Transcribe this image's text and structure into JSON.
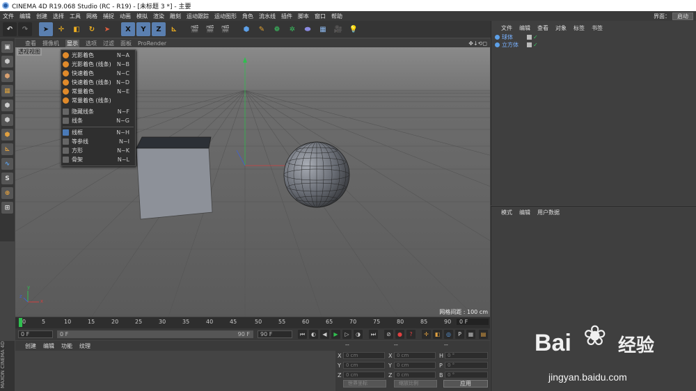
{
  "window": {
    "title": "CINEMA 4D R19.068 Studio (RC - R19) - [未标题 3 *] - 主要"
  },
  "menubar": {
    "items": [
      "文件",
      "编辑",
      "创建",
      "选择",
      "工具",
      "网格",
      "捕捉",
      "动画",
      "模拟",
      "渲染",
      "雕刻",
      "运动跟踪",
      "运动图形",
      "角色",
      "流水线",
      "插件",
      "脚本",
      "窗口",
      "帮助"
    ],
    "layout_label": "界面：",
    "layout_value": "启动"
  },
  "toolbar": {
    "axis_x": "X",
    "axis_y": "Y",
    "axis_z": "Z"
  },
  "viewport_menu": {
    "items": [
      "查看",
      "摄像机",
      "显示",
      "选项",
      "过滤",
      "面板",
      "ProRender"
    ],
    "active": "显示",
    "nav_icons": "✥↓⟲◻"
  },
  "viewport": {
    "label": "透视视图",
    "grid_spacing": "网格间距 : 100 cm",
    "axis_x": "x",
    "axis_y": "y",
    "axis_z": "z"
  },
  "display_menu": {
    "items": [
      {
        "label": "光影着色",
        "shortcut": "N~A",
        "icon": "orange"
      },
      {
        "label": "光影着色 (线条)",
        "shortcut": "N~B",
        "icon": "orange"
      },
      {
        "label": "快速着色",
        "shortcut": "N~C",
        "icon": "orange"
      },
      {
        "label": "快速着色 (线条)",
        "shortcut": "N~D",
        "icon": "orange"
      },
      {
        "label": "常量着色",
        "shortcut": "N~E",
        "icon": "orange"
      },
      {
        "label": "常量着色 (线条)",
        "shortcut": "",
        "icon": "orange"
      },
      {
        "label": "隐藏线条",
        "shortcut": "N~F",
        "icon": "square"
      },
      {
        "label": "线条",
        "shortcut": "N~G",
        "icon": "square"
      },
      {
        "label": "线框",
        "shortcut": "N~H",
        "icon": "blue"
      },
      {
        "label": "等参线",
        "shortcut": "N~I",
        "icon": "square"
      },
      {
        "label": "方形",
        "shortcut": "N~K",
        "icon": "square"
      },
      {
        "label": "骨架",
        "shortcut": "N~L",
        "icon": "square"
      }
    ]
  },
  "timeline": {
    "ticks": [
      "0",
      "5",
      "10",
      "15",
      "20",
      "25",
      "30",
      "35",
      "40",
      "45",
      "50",
      "55",
      "60",
      "65",
      "70",
      "75",
      "80",
      "85",
      "90"
    ],
    "current_frame": "0 F"
  },
  "transport": {
    "start": "0 F",
    "range_start": "0 F",
    "range_end": "90 F",
    "end": "90 F"
  },
  "materials_menu": {
    "items": [
      "创建",
      "编辑",
      "功能",
      "纹理"
    ]
  },
  "coordinates": {
    "headers": [
      "--",
      "--",
      "--"
    ],
    "rows": [
      {
        "a": "X",
        "av": "0 cm",
        "b": "X",
        "bv": "0 cm",
        "c": "H",
        "cv": "0 °"
      },
      {
        "a": "Y",
        "av": "0 cm",
        "b": "Y",
        "bv": "0 cm",
        "c": "P",
        "cv": "0 °"
      },
      {
        "a": "Z",
        "av": "0 cm",
        "b": "Z",
        "bv": "0 cm",
        "c": "B",
        "cv": "0 °"
      }
    ],
    "world_combo": "世界坐标",
    "scale_combo": "缩放比例",
    "apply": "应用"
  },
  "object_manager": {
    "menu": [
      "文件",
      "编辑",
      "查看",
      "对象",
      "标签",
      "书签"
    ],
    "objects": [
      "球体",
      "立方体"
    ]
  },
  "attribute_manager": {
    "menu": [
      "模式",
      "编辑",
      "用户数据"
    ]
  },
  "branding": {
    "maxon": "MAXON CINEMA 4D"
  },
  "watermark": {
    "brand": "Bai",
    "brand_cn": "经验",
    "url": "jingyan.baidu.com"
  },
  "colors": {
    "accent": "#5a7fb0",
    "playhead": "#2fbf4f",
    "object_blue": "#7ab2ff",
    "menu_orange": "#e08a2a"
  }
}
